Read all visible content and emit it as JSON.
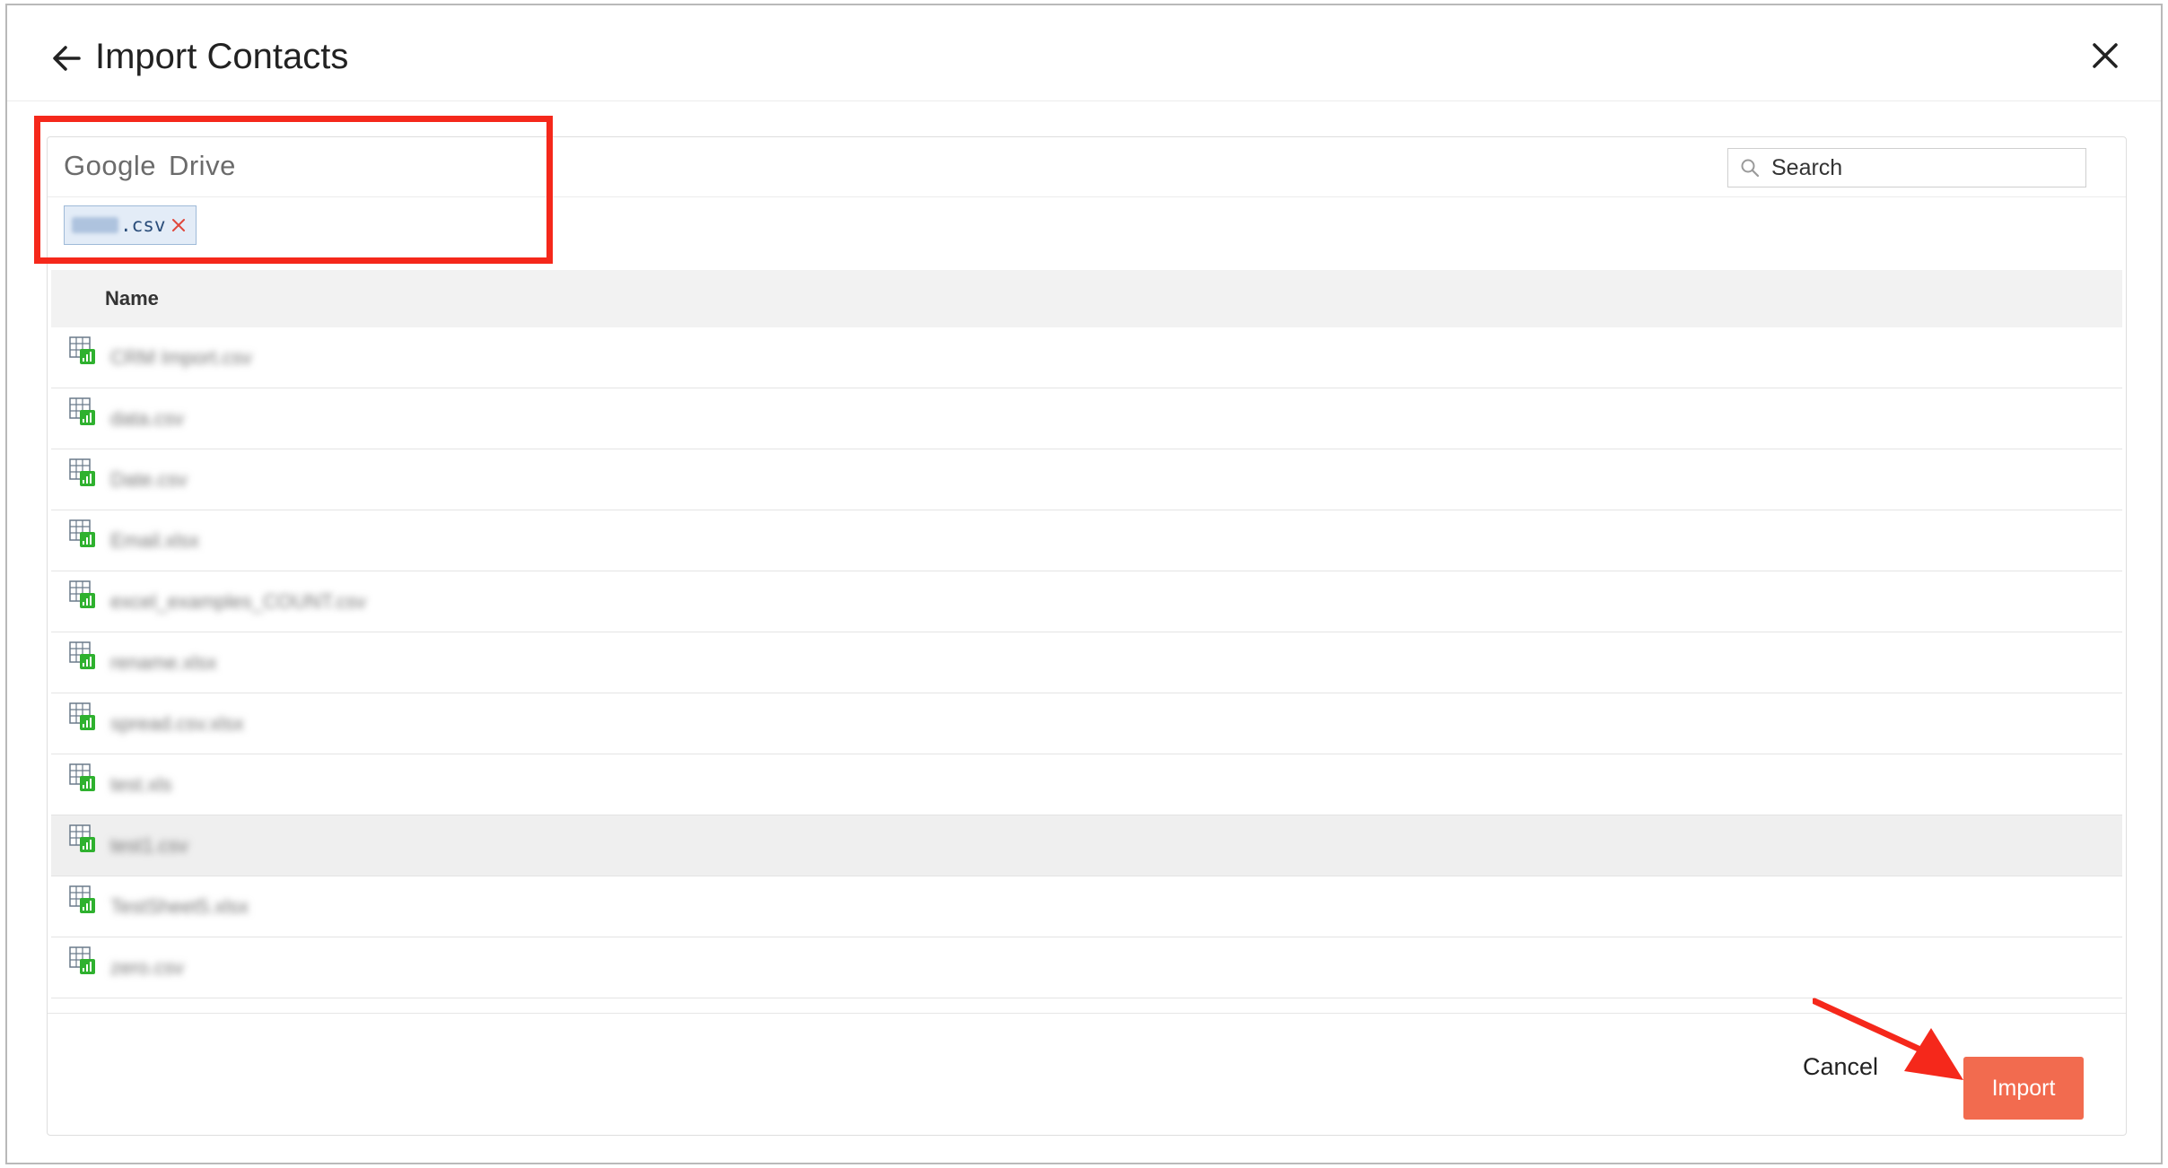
{
  "header": {
    "title": "Import Contacts"
  },
  "source": {
    "provider_part1": "Google",
    "provider_part2": "Drive"
  },
  "search": {
    "placeholder": "Search"
  },
  "selected_chip": {
    "extension": ".csv"
  },
  "table": {
    "column_name": "Name",
    "rows": [
      {
        "name": "CRM Import.csv"
      },
      {
        "name": "data.csv"
      },
      {
        "name": "Date.csv"
      },
      {
        "name": "Email.xlsx"
      },
      {
        "name": "excel_examples_COUNT.csv"
      },
      {
        "name": "rename.xlsx"
      },
      {
        "name": "spread.csv.xlsx"
      },
      {
        "name": "test.xls"
      },
      {
        "name": "test1.csv"
      },
      {
        "name": "TestSheet5.xlsx"
      },
      {
        "name": "zero.csv"
      }
    ],
    "selected_row_index": 8
  },
  "footer": {
    "cancel_label": "Cancel",
    "import_label": "Import"
  },
  "colors": {
    "accent": "#f26b4f",
    "annotation": "#f5281b",
    "file_icon_green": "#2fb12f"
  },
  "icons": [
    "arrow-left-icon",
    "close-icon",
    "search-icon",
    "remove-icon",
    "spreadsheet-file-icon"
  ]
}
